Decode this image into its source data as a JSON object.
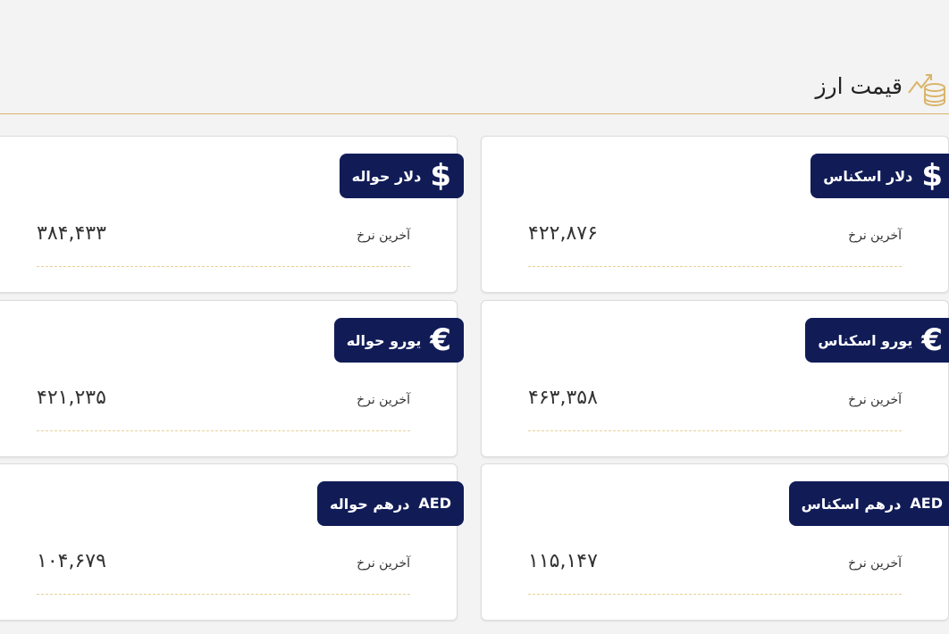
{
  "header": {
    "title": "قیمت ارز",
    "icon": "coins-chart-icon",
    "accent": "#d9b56b"
  },
  "badge_color": "#111c57",
  "cards": [
    {
      "id": "usd-cash",
      "icon": "dollar-icon",
      "symbol": "$",
      "label": "دلار اسکناس",
      "rate_label": "آخرین نرخ",
      "value": "۴۲۲,۸۷۶"
    },
    {
      "id": "usd-transfer",
      "icon": "dollar-icon",
      "symbol": "$",
      "label": "دلار حواله",
      "rate_label": "آخرین نرخ",
      "value": "۳۸۴,۴۳۳"
    },
    {
      "id": "eur-cash",
      "icon": "euro-icon",
      "symbol": "€",
      "label": "یورو اسکناس",
      "rate_label": "آخرین نرخ",
      "value": "۴۶۳,۳۵۸"
    },
    {
      "id": "eur-transfer",
      "icon": "euro-icon",
      "symbol": "€",
      "label": "یورو حواله",
      "rate_label": "آخرین نرخ",
      "value": "۴۲۱,۲۳۵"
    },
    {
      "id": "aed-cash",
      "icon": "aed-icon",
      "symbol": "AED",
      "label": "درهم اسکناس",
      "rate_label": "آخرین نرخ",
      "value": "۱۱۵,۱۴۷"
    },
    {
      "id": "aed-transfer",
      "icon": "aed-icon",
      "symbol": "AED",
      "label": "درهم حواله",
      "rate_label": "آخرین نرخ",
      "value": "۱۰۴,۶۷۹"
    }
  ]
}
